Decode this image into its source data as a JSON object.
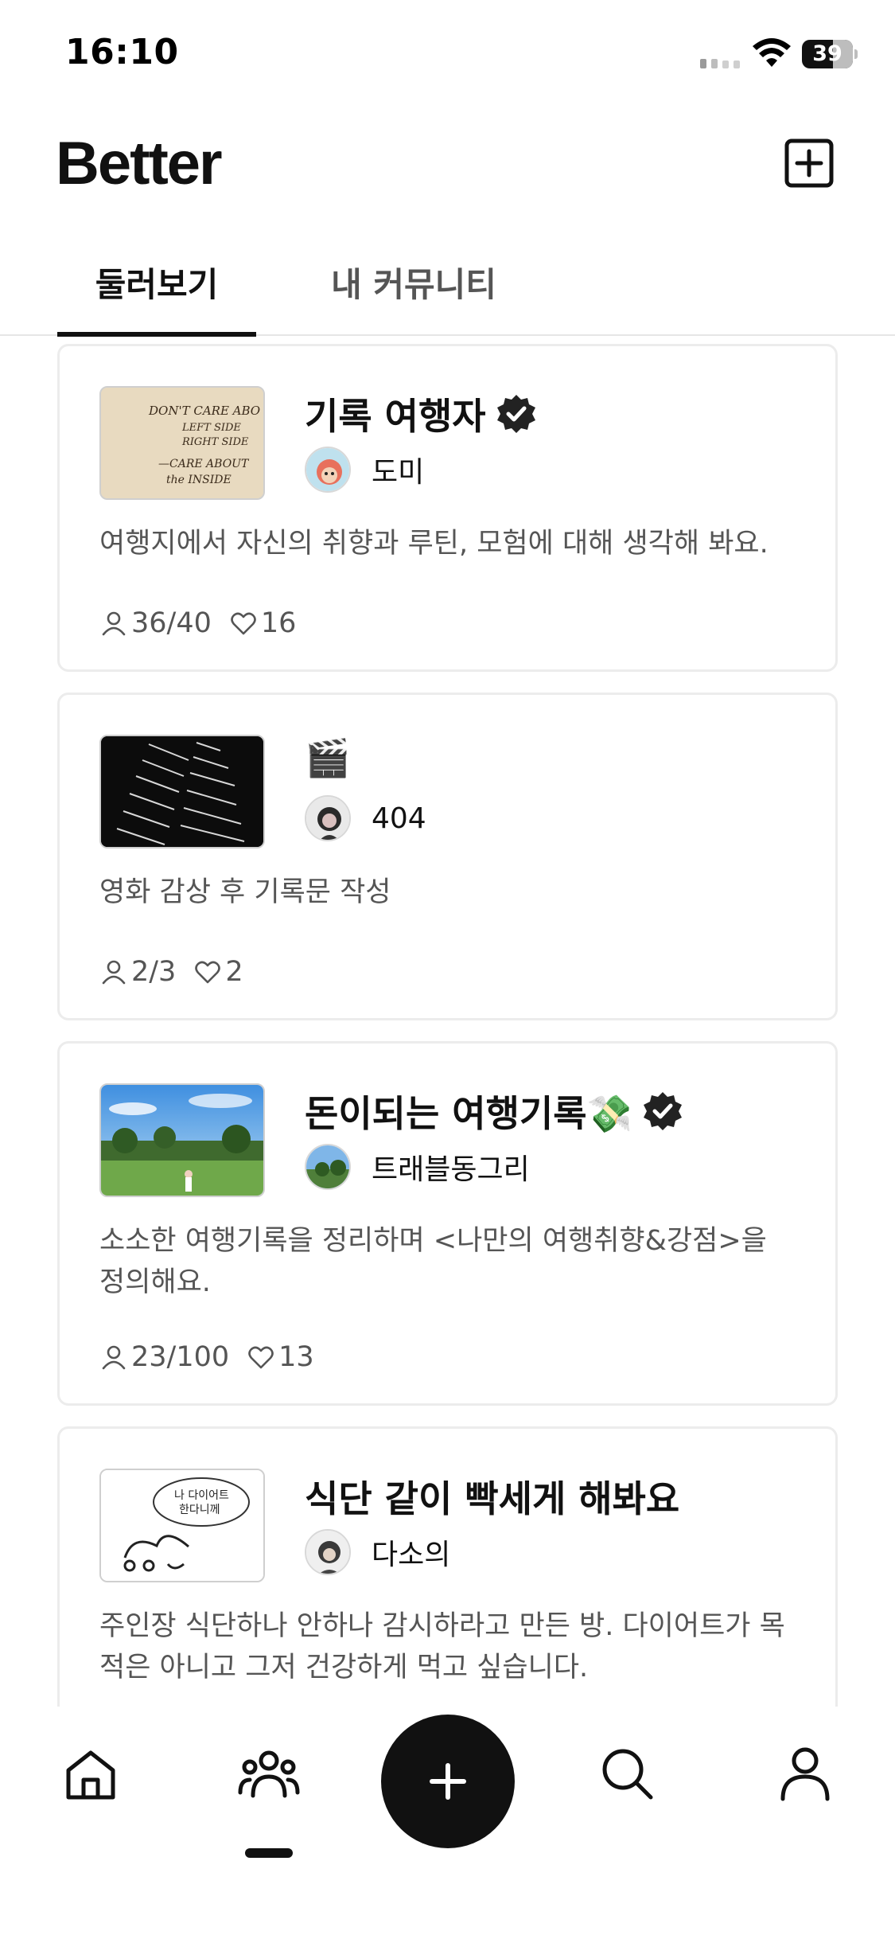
{
  "status_bar": {
    "time": "16:10",
    "battery": "39"
  },
  "header": {
    "logo": "Better",
    "add_icon": "plus-square-icon"
  },
  "tabs": [
    {
      "label": "둘러보기",
      "active": true
    },
    {
      "label": "내 커뮤니티",
      "active": false
    }
  ],
  "feed": [
    {
      "title": "기록 여행자",
      "verified": true,
      "host": "도미",
      "description": "여행지에서 자신의 취향과 루틴, 모험에 대해 생각해 봐요.",
      "members": "36/40",
      "likes": "16",
      "thumb_text": "DON'T CARE ABOUT LEFT SIDE RIGHT SIDE —CARE ABOUT the INSIDE"
    },
    {
      "title": "🎬",
      "verified": false,
      "host": "404",
      "description": "영화 감상 후 기록문 작성",
      "members": "2/3",
      "likes": "2"
    },
    {
      "title": "돈이되는 여행기록💸",
      "verified": true,
      "host": "트래블동그리",
      "description": "소소한 여행기록을 정리하며 <나만의 여행취향&강점>을 정의해요.",
      "members": "23/100",
      "likes": "13"
    },
    {
      "title": "식단 같이 빡세게 해봐요",
      "verified": false,
      "host": "다소의",
      "description": "주인장 식단하나 안하나 감시하라고 만든 방. 다이어트가 목적은 아니고 그저 건강하게 먹고 싶습니다.",
      "members": "",
      "likes": "",
      "thumb_text": "나 다이어트 한다니께"
    }
  ],
  "bottom_nav": {
    "items": [
      "home-icon",
      "community-icon",
      "plus-icon",
      "search-icon",
      "profile-icon"
    ],
    "active": "community-icon"
  }
}
